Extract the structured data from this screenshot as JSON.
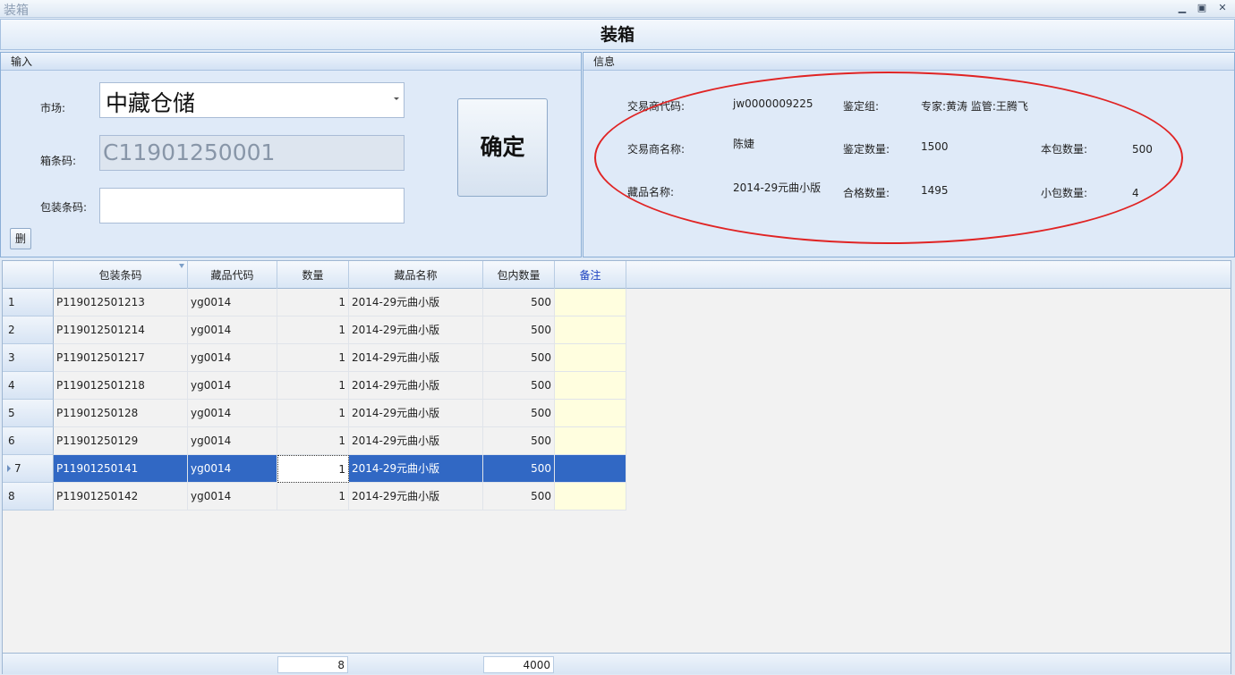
{
  "window": {
    "title": "装箱",
    "minimize": "▁",
    "maximize": "▣",
    "close": "✕"
  },
  "header": {
    "title": "装箱"
  },
  "input_panel": {
    "caption": "输入",
    "market_label": "市场:",
    "market_value": "中藏仓储",
    "box_code_label": "箱条码:",
    "box_code_value": "C11901250001",
    "package_code_label": "包装条码:",
    "package_code_value": "",
    "confirm_label": "确定",
    "delete_label": "删"
  },
  "info_panel": {
    "caption": "信息",
    "trader_code_label": "交易商代码:",
    "trader_code_value": "jw0000009225",
    "appraisal_group_label": "鉴定组:",
    "appraisal_group_value": "专家:黄涛  监管:王腾飞",
    "trader_name_label": "交易商名称:",
    "trader_name_value": "陈婕",
    "appraisal_qty_label": "鉴定数量:",
    "appraisal_qty_value": "1500",
    "package_qty_label": "本包数量:",
    "package_qty_value": "500",
    "item_name_label": "藏品名称:",
    "item_name_value": "2014-29元曲小版",
    "qualified_qty_label": "合格数量:",
    "qualified_qty_value": "1495",
    "small_pkg_qty_label": "小包数量:",
    "small_pkg_qty_value": "4"
  },
  "grid": {
    "columns": [
      "包装条码",
      "藏品代码",
      "数量",
      "藏品名称",
      "包内数量",
      "备注"
    ],
    "rows": [
      {
        "idx": "1",
        "package_code": "P119012501213",
        "item_code": "yg0014",
        "qty": "1",
        "item_name": "2014-29元曲小版",
        "pkg_qty": "500",
        "remark": ""
      },
      {
        "idx": "2",
        "package_code": "P119012501214",
        "item_code": "yg0014",
        "qty": "1",
        "item_name": "2014-29元曲小版",
        "pkg_qty": "500",
        "remark": ""
      },
      {
        "idx": "3",
        "package_code": "P119012501217",
        "item_code": "yg0014",
        "qty": "1",
        "item_name": "2014-29元曲小版",
        "pkg_qty": "500",
        "remark": ""
      },
      {
        "idx": "4",
        "package_code": "P119012501218",
        "item_code": "yg0014",
        "qty": "1",
        "item_name": "2014-29元曲小版",
        "pkg_qty": "500",
        "remark": ""
      },
      {
        "idx": "5",
        "package_code": "P11901250128",
        "item_code": "yg0014",
        "qty": "1",
        "item_name": "2014-29元曲小版",
        "pkg_qty": "500",
        "remark": ""
      },
      {
        "idx": "6",
        "package_code": "P11901250129",
        "item_code": "yg0014",
        "qty": "1",
        "item_name": "2014-29元曲小版",
        "pkg_qty": "500",
        "remark": ""
      },
      {
        "idx": "7",
        "package_code": "P11901250141",
        "item_code": "yg0014",
        "qty": "1",
        "item_name": "2014-29元曲小版",
        "pkg_qty": "500",
        "remark": ""
      },
      {
        "idx": "8",
        "package_code": "P11901250142",
        "item_code": "yg0014",
        "qty": "1",
        "item_name": "2014-29元曲小版",
        "pkg_qty": "500",
        "remark": ""
      }
    ],
    "selected_row": "7",
    "footer": {
      "qty_total": "8",
      "pkg_qty_total": "4000"
    }
  },
  "colors": {
    "selection": "#3168c4",
    "annotation": "#e02424",
    "remark_bg": "#fffedf"
  }
}
